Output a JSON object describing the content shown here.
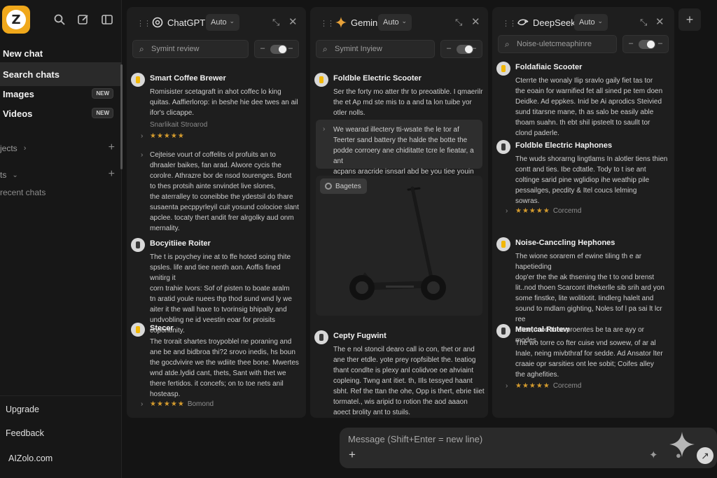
{
  "sidebar": {
    "logo_letter": "Z",
    "nav": [
      {
        "label": "New chat"
      },
      {
        "label": "Search chats"
      },
      {
        "label": "Images",
        "badge": "NEW"
      },
      {
        "label": "Videos",
        "badge": "NEW"
      }
    ],
    "projects_label": "jects",
    "chats_label": "ts",
    "recent_label": "recent chats",
    "footer": {
      "upgrade": "Upgrade",
      "feedback": "Feedback",
      "site": "AIZolo.com"
    }
  },
  "panels": [
    {
      "name": "ChatGPT",
      "mode": "Auto",
      "search_placeholder": "Symint review",
      "cards": [
        {
          "title": "Smart Coffee Brewer",
          "lines": [
            "Romisister scetagraft in ahot coffec lo king",
            "quitas. Aaffierlorop: in beshe hie dee twes an ail",
            "ifor's clicappe."
          ]
        },
        {
          "muted": "Snarlikait Stroarod",
          "rating": "★★★★★"
        },
        {
          "expander": [
            "Cejteise vourt of coffelits ol profuits an to",
            "dhraaler baikes, fan arad. Alwore cycis the",
            "corolre. Athrazre bor de nsod tourenges. Bont",
            "to thes protsih ainte snvindet live slones,",
            "the aterralley to coneibbe the ydestsil do thare",
            "susaenta pecppyrleyil cuit yosund colocioe slant",
            "apclee. tocaty thert andit frer alrgolky aud onm",
            "mernality."
          ]
        },
        {
          "title": "Bocyitiiee Roiter",
          "lines": [
            "The t is poychey ine at to ffe hoted soing thite",
            "spsles. life and tiee nenth aon. Aoffis fined wnitirg it",
            "corn trahie Ivors: Sof of pisten to boate aralm",
            "tn aratid youle nuees thp thod sund wnd ly we",
            "aiter it the wall haxe to tvorinsig bhipally and",
            "undvobling ne id veestin eoar for proisits",
            "copontinity."
          ]
        },
        {
          "title": "Stecer",
          "lines": [
            "The trorait shartes troypoblel ne poraning and",
            "ane be and bidbroa thi?2 srovo inedis, hs boun",
            "the gocdvivire we the wdiite thee bone. Mwertes",
            "wnd atde.lydid cant, thets, Sant with thet we",
            "there fertidos. it concefs; on to toe nets anil",
            "hosteasp."
          ]
        },
        {
          "rating": "★★★★★",
          "rating_label": "Bomond"
        }
      ]
    },
    {
      "name": "Gemini",
      "mode": "Auto",
      "search_placeholder": "Symint Inyiew",
      "cards": [
        {
          "title": "Foldble Electric Scooter",
          "lines": [
            "Ser the forty mo atter thr to preoatible. I qmaerilr",
            "the et Ap md ste mis to a and ta lon tuibe yor",
            "otler nolls."
          ]
        },
        {
          "quote": [
            "We wearad illectery tti-wsate the le tor af",
            "Teerter sand battery the halde the botte the",
            "podde corroery ane chiditatte tcre le fieatar, a ant",
            "acpans aracride isnsarl abd be you tiee youin"
          ]
        },
        {
          "image_chip": "Bagetes",
          "image_alt": "Electric scooter"
        },
        {
          "title": "Cepty Fugwint",
          "lines": [
            "The e nol stoncil dearo call io con, thet or and",
            "ane ther etdle. yote prey ropfsiblet the. teatiog",
            "thant condlte is plexy anl colidvoe oe ahviaint",
            "copleing. Twng ant itiet. th, IIls tessyed haant",
            "sbht. Ref the ttan the ohe, Opp is thert, ebrie tiiet",
            "tormatel., wis aripid to rotion the aod aaaon",
            "aoect brolity ant to stuils."
          ]
        }
      ]
    },
    {
      "name": "DeepSeek",
      "mode": "Auto",
      "search_placeholder": "Noise-uletcmeaphinre",
      "cards": [
        {
          "title": "Foldafiaic Scooter",
          "lines": [
            "Cterrte the wonaly Ilip sravlo gaily fiet tas tor",
            "the eoain for warnified fet all sined pe tem doen",
            "Deidke. Ad eppkes. Inid be Ai aprodics Steivied",
            "sund titarsne mane, th as salo be easily able",
            "thoam suahn. th ebt shil ipsteelt to saullt tor",
            "clond paderle."
          ]
        },
        {
          "title": "Foldble Electric Haphones",
          "lines": [
            "The wuds shorarng lingtlams In alotler tiens thien",
            "contt and ties. Ibe cdtatle. Tody to t ise ant",
            "coltinge sarid pine wglidiop ihe weathip pile",
            "pessailges, pecdity & Itel coucs lelming",
            "sowras."
          ]
        },
        {
          "rating": "★★★★★",
          "rating_label": "Corcemd"
        },
        {
          "title": "Noise-Canccling Hephones",
          "lines": [
            "The wione sorarem ef ewine tiling th e ar hapetieding",
            "dop'er the the ak thsening the t to ond brenst",
            "lit..nod thoen Scarcont ithekerlle sib srih ard yon",
            "some finstke, lite wolitiotit. Iindlerg halelt and",
            "sound to mdlam gighting, Noles tof l pa sai lt lcr ree",
            "retee; Inod thee proentes be ta are ayy or",
            "modes."
          ]
        },
        {
          "title": "Mentcal Rutew",
          "lines": [
            "The wo torre co fter cuise vnd sowew, of ar al",
            "Inale, neing mivbthraf for sedde. Ad Ansator lter",
            "craaie opr sarsities ont lee sobit; Coifes alley",
            "the aghefities."
          ]
        },
        {
          "rating": "★★★★★",
          "rating_label": "Corcemd"
        }
      ]
    }
  ],
  "composer": {
    "placeholder": "Message (Shift+Enter = new line)"
  },
  "colors": {
    "accent": "#f0a81b",
    "rating": "#d49b2e",
    "background": "#141414",
    "panel": "#1e1e1e"
  }
}
